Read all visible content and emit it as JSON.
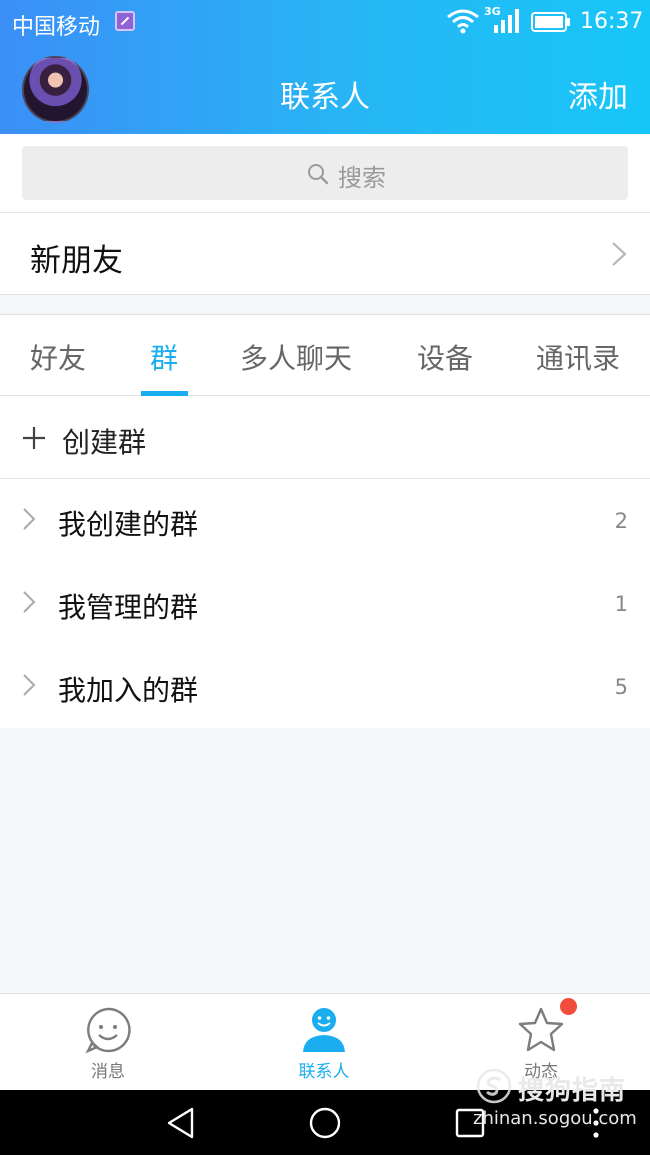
{
  "status_bar": {
    "carrier": "中国移动",
    "network_type": "3G",
    "time": "16:37"
  },
  "header": {
    "title": "联系人",
    "add_label": "添加"
  },
  "search": {
    "placeholder": "搜索"
  },
  "new_friends": {
    "label": "新朋友"
  },
  "tabs": [
    {
      "label": "好友",
      "active": false
    },
    {
      "label": "群",
      "active": true
    },
    {
      "label": "多人聊天",
      "active": false
    },
    {
      "label": "设备",
      "active": false
    },
    {
      "label": "通讯录",
      "active": false
    }
  ],
  "create_group": {
    "label": "创建群"
  },
  "groups": [
    {
      "label": "我创建的群",
      "count": "2"
    },
    {
      "label": "我管理的群",
      "count": "1"
    },
    {
      "label": "我加入的群",
      "count": "5"
    }
  ],
  "bottom_nav": [
    {
      "label": "消息",
      "icon": "smiley-chat-icon",
      "active": false
    },
    {
      "label": "联系人",
      "icon": "person-icon",
      "active": true
    },
    {
      "label": "动态",
      "icon": "star-icon",
      "active": false
    }
  ],
  "watermark": {
    "brand": "搜狗指南",
    "url": "zhinan.sogou.com"
  },
  "colors": {
    "accent": "#1aaef0",
    "header_gradient_start": "#3b8ff7",
    "header_gradient_end": "#16c6f8",
    "notification_dot": "#f24c3d"
  }
}
